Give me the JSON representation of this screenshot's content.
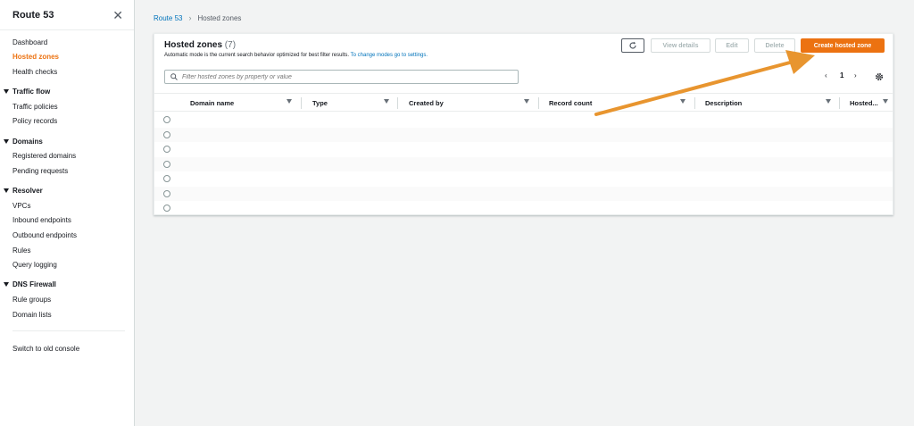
{
  "sidebar": {
    "title": "Route 53",
    "close_glyph": "✕",
    "items": [
      {
        "label": "Dashboard"
      },
      {
        "label": "Hosted zones"
      },
      {
        "label": "Health checks"
      },
      {
        "label": "Traffic flow"
      },
      {
        "label": "Traffic policies"
      },
      {
        "label": "Policy records"
      },
      {
        "label": "Domains"
      },
      {
        "label": "Registered domains"
      },
      {
        "label": "Pending requests"
      },
      {
        "label": "Resolver"
      },
      {
        "label": "VPCs"
      },
      {
        "label": "Inbound endpoints"
      },
      {
        "label": "Outbound endpoints"
      },
      {
        "label": "Rules"
      },
      {
        "label": "Query logging"
      },
      {
        "label": "DNS Firewall"
      },
      {
        "label": "Rule groups"
      },
      {
        "label": "Domain lists"
      },
      {
        "label": "Switch to old console"
      }
    ]
  },
  "breadcrumb": {
    "root": "Route 53",
    "separator": "›",
    "current": "Hosted zones"
  },
  "panel": {
    "title": "Hosted zones",
    "count": "(7)",
    "description": "Automatic mode is the current search behavior optimized for best filter results.",
    "description_link": "To change modes go to settings.",
    "buttons": {
      "view_details": "View details",
      "edit": "Edit",
      "delete": "Delete",
      "create": "Create hosted zone"
    },
    "search": {
      "placeholder": "Filter hosted zones by property or value"
    },
    "pagination": {
      "prev": "‹",
      "page": "1",
      "next": "›"
    },
    "columns": [
      "Domain name",
      "Type",
      "Created by",
      "Record count",
      "Description",
      "Hosted..."
    ],
    "rows": 7
  },
  "colors": {
    "accent": "#ec7211",
    "link": "#0073bb",
    "annotation_arrow": "#e8952f"
  }
}
